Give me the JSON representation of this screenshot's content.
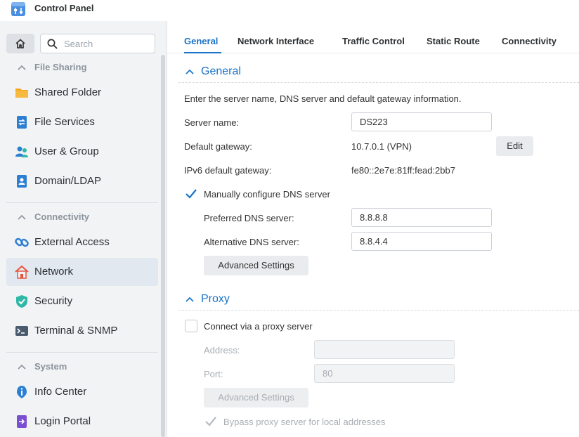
{
  "window": {
    "title": "Control Panel"
  },
  "sidebar": {
    "search_placeholder": "Search",
    "sections": [
      {
        "title": "File Sharing",
        "items": [
          {
            "label": "Shared Folder",
            "icon": "folder-icon"
          },
          {
            "label": "File Services",
            "icon": "file-services-icon"
          },
          {
            "label": "User & Group",
            "icon": "users-icon"
          },
          {
            "label": "Domain/LDAP",
            "icon": "domain-icon"
          }
        ]
      },
      {
        "title": "Connectivity",
        "items": [
          {
            "label": "External Access",
            "icon": "link-icon"
          },
          {
            "label": "Network",
            "icon": "house-icon",
            "active": true
          },
          {
            "label": "Security",
            "icon": "shield-icon"
          },
          {
            "label": "Terminal & SNMP",
            "icon": "terminal-icon"
          }
        ]
      },
      {
        "title": "System",
        "items": [
          {
            "label": "Info Center",
            "icon": "info-icon"
          },
          {
            "label": "Login Portal",
            "icon": "login-portal-icon"
          }
        ]
      }
    ]
  },
  "tabs": [
    "General",
    "Network Interface",
    "Traffic Control",
    "Static Route",
    "Connectivity"
  ],
  "general": {
    "title": "General",
    "description": "Enter the server name, DNS server and default gateway information.",
    "server_name_label": "Server name:",
    "server_name_value": "DS223",
    "gateway_label": "Default gateway:",
    "gateway_value": "10.7.0.1 (VPN)",
    "edit_label": "Edit",
    "ipv6_label": "IPv6 default gateway:",
    "ipv6_value": "fe80::2e7e:81ff:fead:2bb7",
    "manual_dns_label": "Manually configure DNS server",
    "manual_dns_checked": true,
    "preferred_dns_label": "Preferred DNS server:",
    "preferred_dns_value": "8.8.8.8",
    "alternative_dns_label": "Alternative DNS server:",
    "alternative_dns_value": "8.8.4.4",
    "advanced_label": "Advanced Settings"
  },
  "proxy": {
    "title": "Proxy",
    "connect_label": "Connect via a proxy server",
    "connect_checked": false,
    "address_label": "Address:",
    "address_value": "",
    "port_label": "Port:",
    "port_value": "80",
    "advanced_label": "Advanced Settings",
    "bypass_label": "Bypass proxy server for local addresses",
    "bypass_checked": true
  },
  "colors": {
    "accent": "#1a73c8",
    "sidebar_bg": "#f1f3f5",
    "active_item_bg": "#e2e8f0"
  }
}
